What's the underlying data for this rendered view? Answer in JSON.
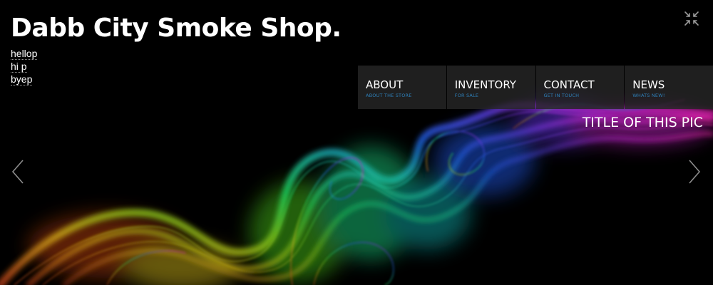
{
  "site": {
    "title": "Dabb City Smoke Shop."
  },
  "mini_links": [
    {
      "label": "hellop"
    },
    {
      "label": "hi p"
    },
    {
      "label": "byep"
    }
  ],
  "nav": [
    {
      "label": "ABOUT",
      "sub": "ABOUT THE STORE"
    },
    {
      "label": "INVENTORY",
      "sub": "FOR SALE"
    },
    {
      "label": "CONTACT",
      "sub": "GET IN TOUCH"
    },
    {
      "label": "NEWS",
      "sub": "WHATS NEW!"
    }
  ],
  "slide": {
    "caption": "TITLE OF THIS PIC"
  },
  "icons": {
    "fullscreen": "fullscreen-icon",
    "prev": "chevron-left-icon",
    "next": "chevron-right-icon"
  },
  "colors": {
    "background": "#000000",
    "nav_bg": "#262626",
    "nav_sub": "#2e7fb8",
    "text": "#ffffff"
  }
}
